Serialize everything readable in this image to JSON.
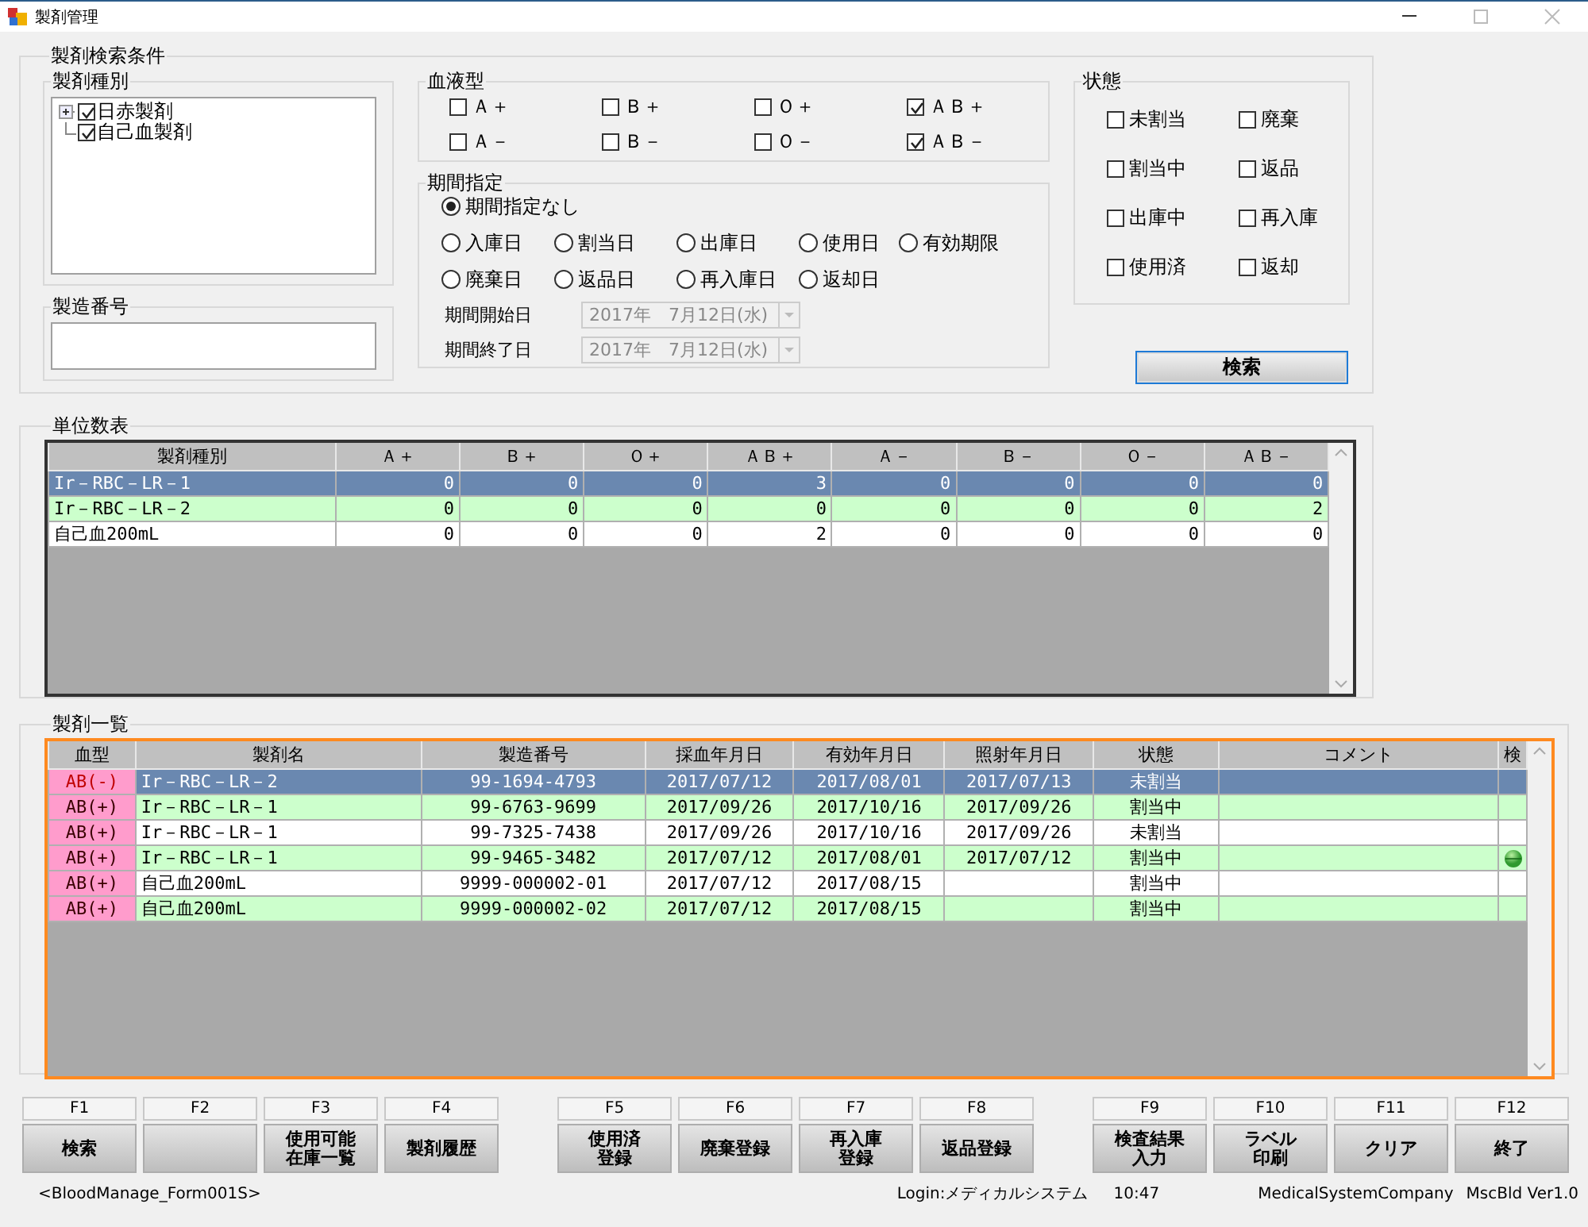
{
  "window": {
    "title": "製剤管理"
  },
  "search_conditions": {
    "title": "製剤検索条件",
    "product_type": {
      "title": "製剤種別",
      "tree": [
        {
          "label": "日赤製剤",
          "checked": true,
          "kind": "group",
          "expanded": false
        },
        {
          "label": "自己血製剤",
          "checked": true,
          "kind": "leaf"
        }
      ]
    },
    "serial_number": {
      "title": "製造番号"
    },
    "blood_type": {
      "title": "血液型",
      "options": [
        {
          "label": "Ａ＋",
          "checked": false
        },
        {
          "label": "Ｂ＋",
          "checked": false
        },
        {
          "label": "Ｏ＋",
          "checked": false
        },
        {
          "label": "ＡＢ＋",
          "checked": true
        },
        {
          "label": "Ａ－",
          "checked": false
        },
        {
          "label": "Ｂ－",
          "checked": false
        },
        {
          "label": "Ｏ－",
          "checked": false
        },
        {
          "label": "ＡＢ－",
          "checked": true
        }
      ]
    },
    "period": {
      "title": "期間指定",
      "options": [
        {
          "label": "期間指定なし",
          "selected": true
        },
        {
          "label": "入庫日",
          "selected": false
        },
        {
          "label": "割当日",
          "selected": false
        },
        {
          "label": "出庫日",
          "selected": false
        },
        {
          "label": "使用日",
          "selected": false
        },
        {
          "label": "有効期限",
          "selected": false
        },
        {
          "label": "廃棄日",
          "selected": false
        },
        {
          "label": "返品日",
          "selected": false
        },
        {
          "label": "再入庫日",
          "selected": false
        },
        {
          "label": "返却日",
          "selected": false
        }
      ],
      "dates": [
        {
          "label": "期間開始日",
          "value": "2017年　7月12日(水)",
          "disabled": true
        },
        {
          "label": "期間終了日",
          "value": "2017年　7月12日(水)",
          "disabled": true
        }
      ]
    },
    "status": {
      "title": "状態",
      "options": [
        {
          "label": "未割当",
          "checked": false
        },
        {
          "label": "廃棄",
          "checked": false
        },
        {
          "label": "割当中",
          "checked": false
        },
        {
          "label": "返品",
          "checked": false
        },
        {
          "label": "出庫中",
          "checked": false
        },
        {
          "label": "再入庫",
          "checked": false
        },
        {
          "label": "使用済",
          "checked": false
        },
        {
          "label": "返却",
          "checked": false
        }
      ]
    },
    "search_button": "検索"
  },
  "unit_table": {
    "title": "単位数表",
    "columns": [
      "製剤種別",
      "Ａ＋",
      "Ｂ＋",
      "Ｏ＋",
      "ＡＢ＋",
      "Ａ－",
      "Ｂ－",
      "Ｏ－",
      "ＡＢ－"
    ],
    "rows": [
      {
        "cells": [
          "Ir－RBC－LR－1",
          "0",
          "0",
          "0",
          "3",
          "0",
          "0",
          "0",
          "0"
        ],
        "selected": true
      },
      {
        "cells": [
          "Ir－RBC－LR－2",
          "0",
          "0",
          "0",
          "0",
          "0",
          "0",
          "0",
          "2"
        ],
        "selected": false
      },
      {
        "cells": [
          "自己血200mL",
          "0",
          "0",
          "0",
          "2",
          "0",
          "0",
          "0",
          "0"
        ],
        "selected": false
      }
    ]
  },
  "product_list": {
    "title": "製剤一覧",
    "columns": [
      "血型",
      "製剤名",
      "製造番号",
      "採血年月日",
      "有効年月日",
      "照射年月日",
      "状態",
      "コメント",
      "検"
    ],
    "rows": [
      {
        "blood_type": "AB(-)",
        "rh_negative": true,
        "name": "Ir－RBC－LR－2",
        "serial": "99-1694-4793",
        "collected": "2017/07/12",
        "expiry": "2017/08/01",
        "irradiated": "2017/07/13",
        "status": "未割当",
        "inspected": false,
        "selected": true
      },
      {
        "blood_type": "AB(+)",
        "rh_negative": false,
        "name": "Ir－RBC－LR－1",
        "serial": "99-6763-9699",
        "collected": "2017/09/26",
        "expiry": "2017/10/16",
        "irradiated": "2017/09/26",
        "status": "割当中",
        "inspected": false,
        "selected": false
      },
      {
        "blood_type": "AB(+)",
        "rh_negative": false,
        "name": "Ir－RBC－LR－1",
        "serial": "99-7325-7438",
        "collected": "2017/09/26",
        "expiry": "2017/10/16",
        "irradiated": "2017/09/26",
        "status": "未割当",
        "inspected": false,
        "selected": false
      },
      {
        "blood_type": "AB(+)",
        "rh_negative": false,
        "name": "Ir－RBC－LR－1",
        "serial": "99-9465-3482",
        "collected": "2017/07/12",
        "expiry": "2017/08/01",
        "irradiated": "2017/07/12",
        "status": "割当中",
        "inspected": true,
        "selected": false
      },
      {
        "blood_type": "AB(+)",
        "rh_negative": false,
        "name": "自己血200mL",
        "serial": "9999-000002-01",
        "collected": "2017/07/12",
        "expiry": "2017/08/15",
        "status": "割当中",
        "inspected": false,
        "selected": false
      },
      {
        "blood_type": "AB(+)",
        "rh_negative": false,
        "name": "自己血200mL",
        "serial": "9999-000002-02",
        "collected": "2017/07/12",
        "expiry": "2017/08/15",
        "status": "割当中",
        "inspected": false,
        "selected": false
      }
    ]
  },
  "function_keys": [
    {
      "key": "F1",
      "lines": [
        "検索"
      ]
    },
    {
      "key": "F2"
    },
    {
      "key": "F3",
      "lines": [
        "使用可能",
        "在庫一覧"
      ]
    },
    {
      "key": "F4",
      "lines": [
        "製剤履歴"
      ]
    },
    {
      "key": "F5",
      "lines": [
        "使用済",
        "登録"
      ]
    },
    {
      "key": "F6",
      "lines": [
        "廃棄登録"
      ]
    },
    {
      "key": "F7",
      "lines": [
        "再入庫",
        "登録"
      ]
    },
    {
      "key": "F8",
      "lines": [
        "返品登録"
      ]
    },
    {
      "key": "F9",
      "lines": [
        "検査結果",
        "入力"
      ]
    },
    {
      "key": "F10",
      "lines": [
        "ラベル",
        "印刷"
      ]
    },
    {
      "key": "F11",
      "lines": [
        "クリア"
      ]
    },
    {
      "key": "F12",
      "lines": [
        "終了"
      ]
    }
  ],
  "status_bar": {
    "form": "<BloodManage_Form001S>",
    "login": "Login:メディカルシステム",
    "time": "10:47",
    "company": "MedicalSystemCompany",
    "version": "MscBld Ver1.0"
  }
}
